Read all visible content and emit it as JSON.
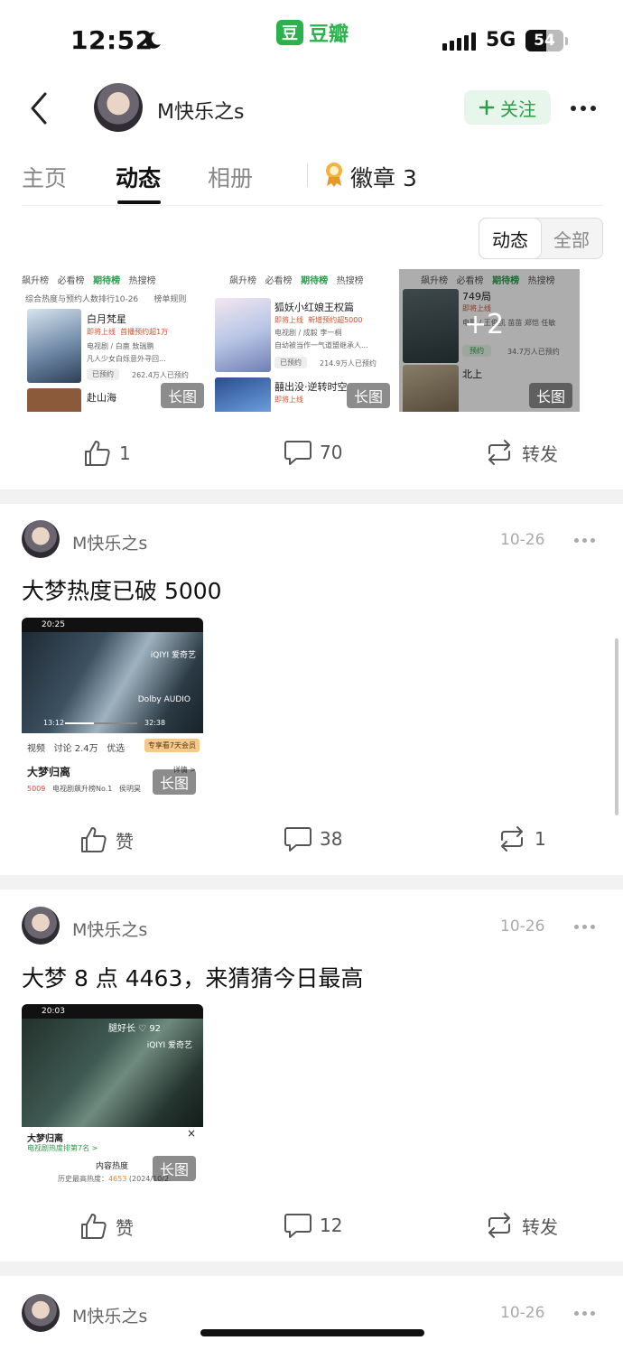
{
  "status_bar": {
    "time": "12:52",
    "network": "5G",
    "battery": "54",
    "battery_level": 0.54
  },
  "app": {
    "brand_mark": "豆",
    "brand_name": "豆瓣"
  },
  "header": {
    "username": "M快乐之s",
    "follow_label": "关注"
  },
  "tabs": {
    "home": "主页",
    "feed": "动态",
    "album": "相册",
    "badge": "徽章",
    "badge_count": "3"
  },
  "filter": {
    "feed": "动态",
    "all": "全部"
  },
  "top_post": {
    "long_tag": "长图",
    "extra_count": "+2",
    "thumb1": {
      "tabs": [
        "飙升榜",
        "必看榜",
        "期待榜",
        "热搜榜"
      ],
      "subtitle": "综合热度与预约人数排行10-26",
      "rules": "榜单规则",
      "title": "白月梵星",
      "tag1": "即将上线",
      "tag2": "首播预约超1万",
      "meta": "电视剧 / 白鹿 敖瑞鹏",
      "desc": "凡人少女白烁意外寻回...",
      "reserved": "已预约",
      "count": "262.4万人已预约",
      "next": "赴山海"
    },
    "thumb2": {
      "tabs": [
        "飙升榜",
        "必看榜",
        "期待榜",
        "热搜榜"
      ],
      "title": "狐妖小红娘王权篇",
      "tag1": "即将上线",
      "tag2": "新增预约超5000",
      "meta": "电视剧 / 成毅 李一桐",
      "desc": "自幼被当作一气道盟继承人...",
      "reserved": "已预约",
      "count": "214.9万人已预约",
      "next": "囍出没·逆转时空",
      "next_tag": "即将上线"
    },
    "thumb3": {
      "tabs": [
        "飙升榜",
        "必看榜",
        "期待榜",
        "热搜榜"
      ],
      "title": "749局",
      "tag1": "即将上线",
      "meta": "电影 / 王俊凯 苗苗 郑恺 任敏",
      "reserve": "预约",
      "count": "34.7万人已预约",
      "next": "北上"
    },
    "likes": "1",
    "comments": "70",
    "share": "转发"
  },
  "posts": [
    {
      "username": "M快乐之s",
      "date": "10-26",
      "text": "大梦热度已破 5000",
      "long_tag": "长图",
      "screen_time": "20:25",
      "video_brand": "iQIYI 爱奇艺",
      "dolby": "Dolby AUDIO",
      "elapsed": "13:12",
      "duration": "32:38",
      "tabs": [
        "视频",
        "讨论 2.4万",
        "优选"
      ],
      "member_badge": "专享看7天会员",
      "show_title": "大梦归离",
      "details": "详情 >",
      "heat": "5009",
      "rank": "电视剧飙升榜No.1",
      "cast": "侯明昊",
      "likes": "赞",
      "comments": "38",
      "shares": "1"
    },
    {
      "username": "M快乐之s",
      "date": "10-26",
      "text": "大梦 8 点 4463，来猜猜今日最高",
      "long_tag": "长图",
      "screen_time": "20:03",
      "top_text": "腿好长 ♡ 92",
      "video_brand": "iQIYI 爱奇艺",
      "show_title": "大梦归离",
      "rank_line": "电视剧热度排第7名 >",
      "close": "×",
      "heat_title": "内容热度",
      "history_label": "历史最高热度：",
      "history_value": "4653",
      "history_date": "(2024/10/2",
      "likes": "赞",
      "comments": "12",
      "share": "转发"
    },
    {
      "username": "M快乐之s",
      "date": "10-26"
    }
  ],
  "colors": {
    "accent_green": "#2bb24c",
    "follow_bg": "#e6f6ea",
    "tag_red": "#d0502c"
  },
  "icons": [
    "moon-icon",
    "back-icon",
    "plus-icon",
    "more-icon",
    "badge-icon",
    "thumbs-up-icon",
    "comment-icon",
    "repost-icon"
  ]
}
